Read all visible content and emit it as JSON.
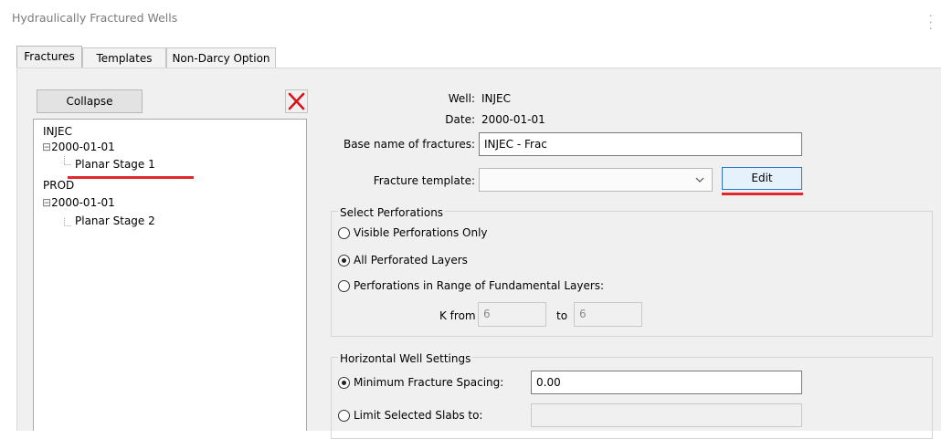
{
  "window": {
    "title": "Hydraulically Fractured Wells"
  },
  "tabs": [
    {
      "label": "Fractures",
      "active": true
    },
    {
      "label": "Templates",
      "active": false
    },
    {
      "label": "Non-Darcy Option",
      "active": false
    }
  ],
  "left": {
    "collapse_label": "Collapse",
    "tree": [
      {
        "label": "INJEC"
      },
      {
        "expander": "⊟",
        "label": "2000-01-01"
      },
      {
        "label": "Planar Stage 1",
        "selected": true
      },
      {
        "label": "PROD"
      },
      {
        "expander": "⊟",
        "label": "2000-01-01"
      },
      {
        "label": "Planar Stage 2"
      }
    ]
  },
  "right": {
    "well_label": "Well:",
    "well_value": "INJEC",
    "date_label": "Date:",
    "date_value": "2000-01-01",
    "base_name_label": "Base name of fractures:",
    "base_name_value": "INJEC - Frac",
    "template_label": "Fracture template:",
    "template_value": "",
    "edit_label": "Edit"
  },
  "perforations": {
    "title": "Select Perforations",
    "options": [
      {
        "label": "Visible Perforations Only",
        "selected": false
      },
      {
        "label": "All Perforated Layers",
        "selected": true
      },
      {
        "label": "Perforations in Range of Fundamental Layers:",
        "selected": false
      }
    ],
    "k_from_label": "K from",
    "k_from_value": "6",
    "k_to_label": "to",
    "k_to_value": "6"
  },
  "horizontal": {
    "title": "Horizontal Well Settings",
    "options": [
      {
        "label": "Minimum Fracture Spacing:",
        "selected": true,
        "value": "0.00"
      },
      {
        "label": "Limit Selected Slabs to:",
        "selected": false,
        "value": ""
      }
    ]
  },
  "colors": {
    "highlight_underline": "#e0272c",
    "edit_border": "#2e76c9",
    "delete_x": "#d8141b"
  }
}
